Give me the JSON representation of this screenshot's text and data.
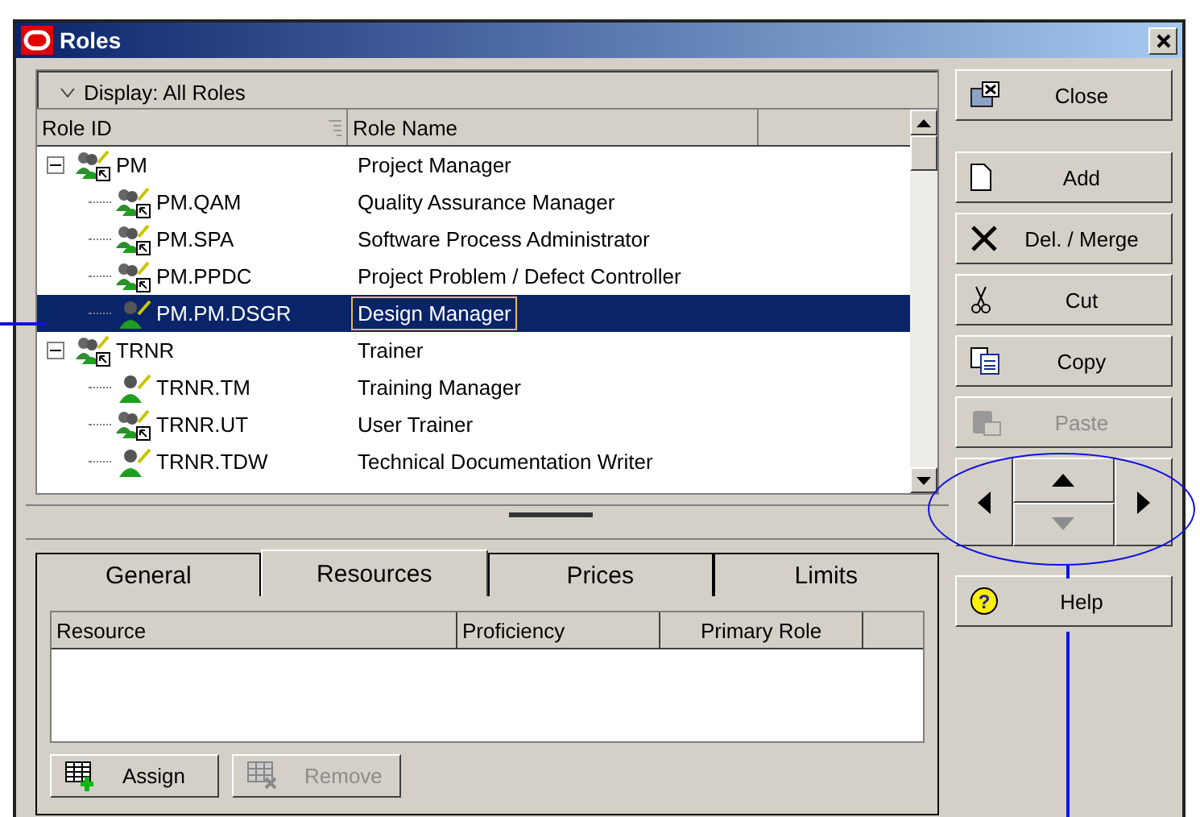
{
  "window": {
    "title": "Roles"
  },
  "filter": {
    "label": "Display: All Roles"
  },
  "tree": {
    "columns": [
      "Role ID",
      "Role Name"
    ],
    "rows": [
      {
        "id": "PM",
        "name": "Project Manager",
        "kind": "group",
        "expanded": true,
        "selected": false,
        "children": [
          {
            "id": "PM.QAM",
            "name": "Quality Assurance Manager",
            "kind": "group",
            "selected": false
          },
          {
            "id": "PM.SPA",
            "name": "Software Process Administrator",
            "kind": "group",
            "selected": false
          },
          {
            "id": "PM.PPDC",
            "name": "Project Problem / Defect Controller",
            "kind": "group",
            "selected": false
          },
          {
            "id": "PM.PM.DSGR",
            "name": "Design Manager",
            "kind": "single",
            "selected": true
          }
        ]
      },
      {
        "id": "TRNR",
        "name": "Trainer",
        "kind": "group",
        "expanded": true,
        "selected": false,
        "children": [
          {
            "id": "TRNR.TM",
            "name": "Training Manager",
            "kind": "single",
            "selected": false
          },
          {
            "id": "TRNR.UT",
            "name": "User Trainer",
            "kind": "group",
            "selected": false
          },
          {
            "id": "TRNR.TDW",
            "name": "Technical Documentation Writer",
            "kind": "single",
            "selected": false
          }
        ]
      }
    ]
  },
  "tabs": [
    {
      "label": "General",
      "selected": false
    },
    {
      "label": "Resources",
      "selected": true
    },
    {
      "label": "Prices",
      "selected": false
    },
    {
      "label": "Limits",
      "selected": false
    }
  ],
  "resources_table": {
    "columns": [
      "Resource",
      "Proficiency",
      "Primary Role"
    ]
  },
  "resource_buttons": [
    {
      "label": "Assign",
      "kind": "assign",
      "disabled": false
    },
    {
      "label": "Remove",
      "kind": "remove",
      "disabled": true
    }
  ],
  "side_buttons": [
    {
      "label": "Close",
      "kind": "close",
      "disabled": false
    },
    {
      "label": "Add",
      "kind": "add",
      "disabled": false
    },
    {
      "label": "Del. / Merge",
      "kind": "delete",
      "disabled": false
    },
    {
      "label": "Cut",
      "kind": "cut",
      "disabled": false
    },
    {
      "label": "Copy",
      "kind": "copy",
      "disabled": false
    },
    {
      "label": "Paste",
      "kind": "paste",
      "disabled": true
    }
  ],
  "move_buttons": [
    {
      "kind": "left",
      "disabled": false
    },
    {
      "kind": "up",
      "disabled": false
    },
    {
      "kind": "down",
      "disabled": true
    },
    {
      "kind": "right",
      "disabled": false
    }
  ],
  "help_button": {
    "label": "Help",
    "icon": "?"
  }
}
